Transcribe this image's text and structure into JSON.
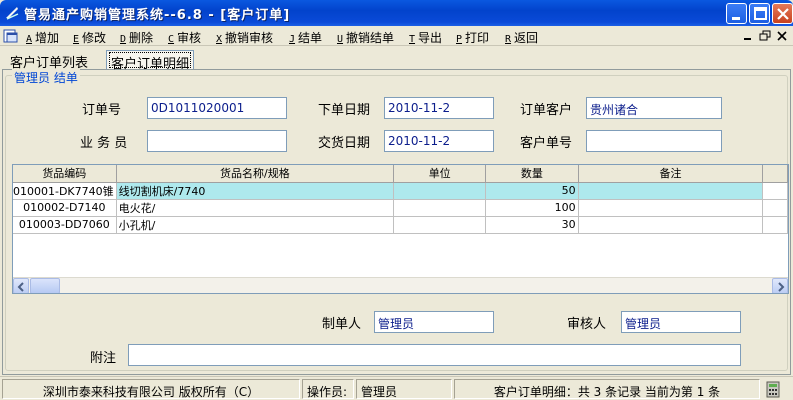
{
  "window": {
    "title": "管易通产购销管理系统--6.8 - [客户订单]"
  },
  "menu": [
    {
      "key": "A",
      "label": "增加"
    },
    {
      "key": "E",
      "label": "修改"
    },
    {
      "key": "D",
      "label": "删除"
    },
    {
      "key": "C",
      "label": "审核"
    },
    {
      "key": "X",
      "label": "撤销审核"
    },
    {
      "key": "J",
      "label": "结单"
    },
    {
      "key": "U",
      "label": "撤销结单"
    },
    {
      "key": "T",
      "label": "导出"
    },
    {
      "key": "P",
      "label": "打印"
    },
    {
      "key": "R",
      "label": "返回"
    }
  ],
  "tabs": {
    "list": "客户订单列表",
    "detail": "客户订单明细"
  },
  "group": {
    "legend": "管理员 结单"
  },
  "form": {
    "order_no_label": "订单号",
    "order_no": "0D1011020001",
    "order_date_label": "下单日期",
    "order_date": "2010-11-2",
    "customer_label": "订单客户",
    "customer": "贵州诸合",
    "salesman_label": "业 务 员",
    "salesman": "",
    "delivery_date_label": "交货日期",
    "delivery_date": "2010-11-2",
    "customer_no_label": "客户单号",
    "customer_no": "",
    "creator_label": "制单人",
    "creator": "管理员",
    "reviewer_label": "审核人",
    "reviewer": "管理员",
    "remark_label": "附注",
    "remark": ""
  },
  "grid": {
    "columns": [
      "货品编码",
      "货品名称/规格",
      "单位",
      "数量",
      "备注"
    ],
    "rows": [
      {
        "code": "010001-DK7740锥",
        "name": "线切割机床/7740",
        "unit": "",
        "qty": "50",
        "note": ""
      },
      {
        "code": "010002-D7140",
        "name": "电火花/",
        "unit": "",
        "qty": "100",
        "note": ""
      },
      {
        "code": "010003-DD7060",
        "name": "小孔机/",
        "unit": "",
        "qty": "30",
        "note": ""
      }
    ]
  },
  "status": {
    "copyright": "深圳市泰来科技有限公司 版权所有（C）",
    "operator_label": "操作员:",
    "operator": "管理员",
    "records": "客户订单明细：共 3 条记录 当前为第 1 条"
  },
  "colors": {
    "titlebar": "#0a4ad8",
    "selected_row": "#aee9ed",
    "legend": "#0046d5",
    "field_text": "#0b1d8c"
  }
}
